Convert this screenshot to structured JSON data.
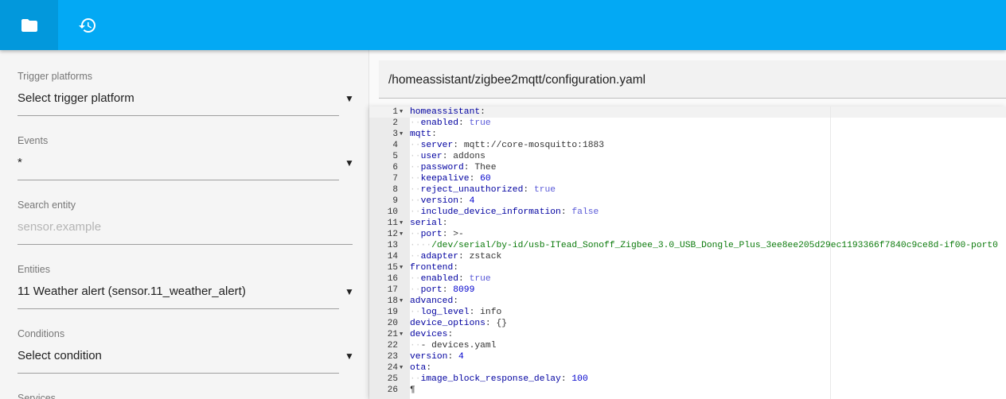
{
  "toolbar": {
    "buttons": [
      {
        "name": "folder-button",
        "icon": "folder-icon",
        "active": true
      },
      {
        "name": "history-button",
        "icon": "history-icon",
        "active": false
      }
    ],
    "color": "#03a9f4"
  },
  "sidebar": {
    "trigger_platforms": {
      "label": "Trigger platforms",
      "value": "Select trigger platform"
    },
    "events": {
      "label": "Events",
      "value": "*"
    },
    "search_entity": {
      "label": "Search entity",
      "placeholder": "sensor.example"
    },
    "entities": {
      "label": "Entities",
      "value": "11 Weather alert (sensor.11_weather_alert)"
    },
    "conditions": {
      "label": "Conditions",
      "value": "Select condition"
    },
    "services": {
      "label": "Services"
    }
  },
  "editor": {
    "file_path": "/homeassistant/zigbee2mqtt/configuration.yaml",
    "lines": [
      {
        "n": "1",
        "fold": true,
        "indent": 0,
        "key": "homeassistant",
        "value": "",
        "vtype": ""
      },
      {
        "n": "2",
        "fold": false,
        "indent": 1,
        "key": "enabled",
        "value": "true",
        "vtype": "bool"
      },
      {
        "n": "3",
        "fold": true,
        "indent": 0,
        "key": "mqtt",
        "value": "",
        "vtype": ""
      },
      {
        "n": "4",
        "fold": false,
        "indent": 1,
        "key": "server",
        "value": "mqtt://core-mosquitto:1883",
        "vtype": "plain"
      },
      {
        "n": "5",
        "fold": false,
        "indent": 1,
        "key": "user",
        "value": "addons",
        "vtype": "plain"
      },
      {
        "n": "6",
        "fold": false,
        "indent": 1,
        "key": "password",
        "value": "Thee",
        "vtype": "plain"
      },
      {
        "n": "7",
        "fold": false,
        "indent": 1,
        "key": "keepalive",
        "value": "60",
        "vtype": "num"
      },
      {
        "n": "8",
        "fold": false,
        "indent": 1,
        "key": "reject_unauthorized",
        "value": "true",
        "vtype": "bool"
      },
      {
        "n": "9",
        "fold": false,
        "indent": 1,
        "key": "version",
        "value": "4",
        "vtype": "num"
      },
      {
        "n": "10",
        "fold": false,
        "indent": 1,
        "key": "include_device_information",
        "value": "false",
        "vtype": "bool"
      },
      {
        "n": "11",
        "fold": true,
        "indent": 0,
        "key": "serial",
        "value": "",
        "vtype": ""
      },
      {
        "n": "12",
        "fold": true,
        "indent": 1,
        "key": "port",
        "value": ">-",
        "vtype": "plain"
      },
      {
        "n": "13",
        "fold": false,
        "indent": 2,
        "key": "",
        "value": "/dev/serial/by-id/usb-ITead_Sonoff_Zigbee_3.0_USB_Dongle_Plus_3ee8ee205d29ec1193366f7840c9ce8d-if00-port0",
        "vtype": "str"
      },
      {
        "n": "14",
        "fold": false,
        "indent": 1,
        "key": "adapter",
        "value": "zstack",
        "vtype": "plain"
      },
      {
        "n": "15",
        "fold": true,
        "indent": 0,
        "key": "frontend",
        "value": "",
        "vtype": ""
      },
      {
        "n": "16",
        "fold": false,
        "indent": 1,
        "key": "enabled",
        "value": "true",
        "vtype": "bool"
      },
      {
        "n": "17",
        "fold": false,
        "indent": 1,
        "key": "port",
        "value": "8099",
        "vtype": "num"
      },
      {
        "n": "18",
        "fold": true,
        "indent": 0,
        "key": "advanced",
        "value": "",
        "vtype": ""
      },
      {
        "n": "19",
        "fold": false,
        "indent": 1,
        "key": "log_level",
        "value": "info",
        "vtype": "plain"
      },
      {
        "n": "20",
        "fold": false,
        "indent": 0,
        "key": "device_options",
        "value": "{}",
        "vtype": "plain"
      },
      {
        "n": "21",
        "fold": true,
        "indent": 0,
        "key": "devices",
        "value": "",
        "vtype": ""
      },
      {
        "n": "22",
        "fold": false,
        "indent": 1,
        "key": "- devices.yaml",
        "value": "",
        "vtype": "list"
      },
      {
        "n": "23",
        "fold": false,
        "indent": 0,
        "key": "version",
        "value": "4",
        "vtype": "num"
      },
      {
        "n": "24",
        "fold": true,
        "indent": 0,
        "key": "ota",
        "value": "",
        "vtype": ""
      },
      {
        "n": "25",
        "fold": false,
        "indent": 1,
        "key": "image_block_response_delay",
        "value": "100",
        "vtype": "num"
      },
      {
        "n": "26",
        "fold": false,
        "indent": 0,
        "key": "",
        "value": "",
        "vtype": ""
      }
    ]
  }
}
